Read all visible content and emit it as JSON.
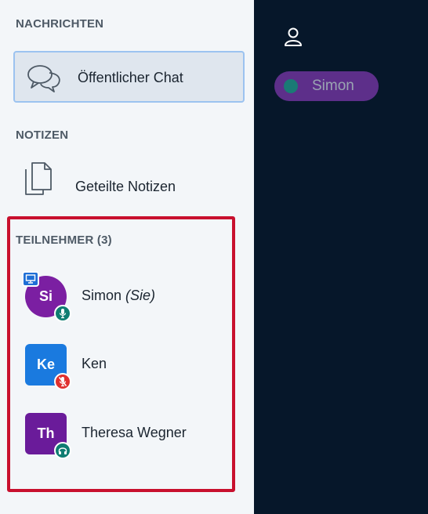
{
  "sidebar": {
    "messages_title": "NACHRICHTEN",
    "public_chat_label": "Öffentlicher Chat",
    "notes_title": "NOTIZEN",
    "shared_notes_label": "Geteilte Notizen",
    "participants_title": "TEILNEHMER (3)",
    "users": [
      {
        "initials": "Si",
        "name": "Simon",
        "suffix": "(Sie)",
        "color": "#7b1fa2",
        "shape": "round",
        "status": "microphone",
        "status_color": "#0f7d72",
        "presenter": true
      },
      {
        "initials": "Ke",
        "name": "Ken",
        "suffix": "",
        "color": "#1a7adf",
        "shape": "square",
        "status": "microphone-muted",
        "status_color": "#e0312f",
        "presenter": false
      },
      {
        "initials": "Th",
        "name": "Theresa Wegner",
        "suffix": "",
        "color": "#6a1b9a",
        "shape": "square",
        "status": "headphones",
        "status_color": "#0f7d72",
        "presenter": false
      }
    ]
  },
  "main": {
    "user_icon": "user-icon",
    "talker_pill_label": "Simon"
  },
  "colors": {
    "sidebar_bg": "#f3f6f9",
    "main_bg": "#06172a",
    "highlight": "#c8102e",
    "chat_border": "#9cc3f0"
  }
}
